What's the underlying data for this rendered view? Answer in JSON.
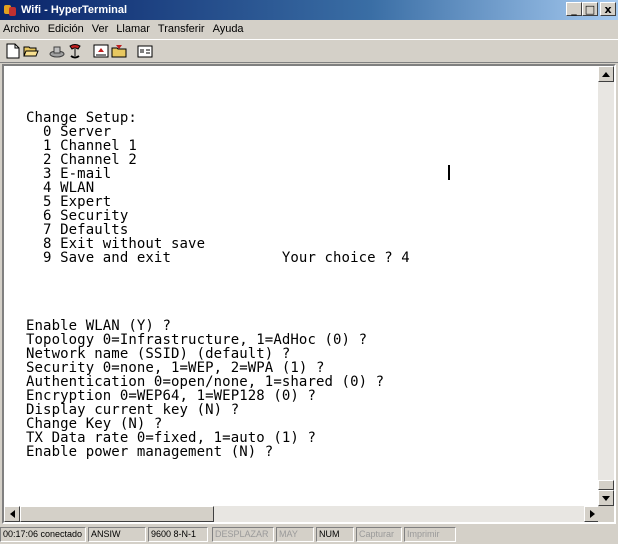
{
  "window": {
    "title": "Wifi - HyperTerminal"
  },
  "title_buttons": {
    "minimize": "_",
    "maximize": "□",
    "close": "x"
  },
  "menu": [
    {
      "label": "Archivo"
    },
    {
      "label": "Edición"
    },
    {
      "label": "Ver"
    },
    {
      "label": "Llamar"
    },
    {
      "label": "Transferir"
    },
    {
      "label": "Ayuda"
    }
  ],
  "toolbar": {
    "buttons": [
      "new-icon",
      "open-icon",
      "disconnect-icon",
      "call-icon",
      "send-icon",
      "receive-icon",
      "properties-icon"
    ]
  },
  "terminal": {
    "lines": [
      "Change Setup:",
      "  0 Server",
      "  1 Channel 1",
      "  2 Channel 2",
      "  3 E-mail",
      "  4 WLAN",
      "  5 Expert",
      "  6 Security",
      "  7 Defaults",
      "  8 Exit without save",
      "  9 Save and exit             Your choice ? 4",
      "",
      "Enable WLAN (Y) ?",
      "Topology 0=Infrastructure, 1=AdHoc (0) ?",
      "Network name (SSID) (default) ?",
      "Security 0=none, 1=WEP, 2=WPA (1) ?",
      "Authentication 0=open/none, 1=shared (0) ?",
      "Encryption 0=WEP64, 1=WEP128 (0) ?",
      "Display current key (N) ?",
      "Change Key (N) ?",
      "TX Data rate 0=fixed, 1=auto (1) ?",
      "Enable power management (N) ?"
    ]
  },
  "status": {
    "time": "00:17:06 conectado",
    "emulation": "ANSIW",
    "port": "9600 8-N-1",
    "scroll": "DESPLAZAR",
    "caps": "MAY",
    "num": "NUM",
    "capture": "Capturar",
    "print": "Imprimir"
  }
}
